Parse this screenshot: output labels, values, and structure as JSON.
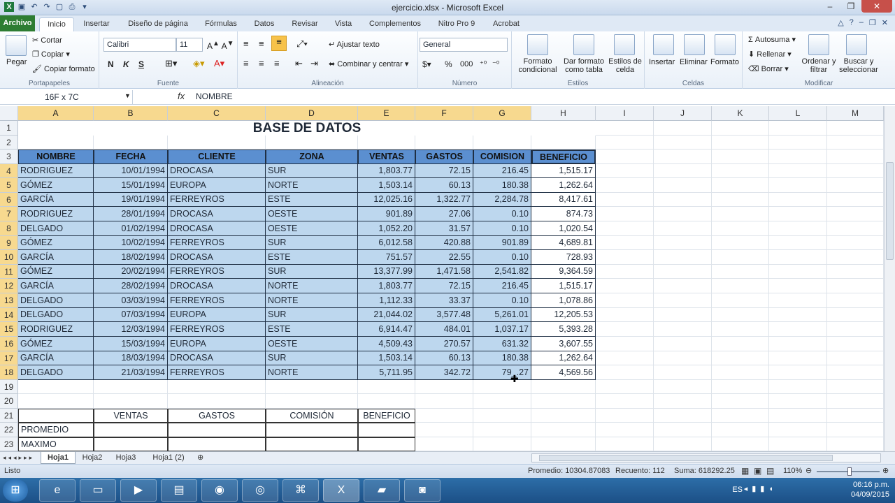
{
  "window": {
    "title": "ejercicio.xlsx - Microsoft Excel"
  },
  "ribbon_tabs": [
    "Archivo",
    "Inicio",
    "Insertar",
    "Diseño de página",
    "Fórmulas",
    "Datos",
    "Revisar",
    "Vista",
    "Complementos",
    "Nitro Pro 9",
    "Acrobat"
  ],
  "clipboard": {
    "paste": "Pegar",
    "cut": "Cortar",
    "copy": "Copiar",
    "format_painter": "Copiar formato",
    "label": "Portapapeles"
  },
  "font": {
    "name": "Calibri",
    "size": "11",
    "label": "Fuente",
    "bold": "N",
    "italic": "K",
    "underline": "S"
  },
  "alignment": {
    "wrap": "Ajustar texto",
    "merge": "Combinar y centrar",
    "label": "Alineación"
  },
  "number": {
    "format": "General",
    "label": "Número",
    "percent": "%",
    "thousands": "000"
  },
  "styles": {
    "conditional": "Formato condicional",
    "as_table": "Dar formato como tabla",
    "cell_styles": "Estilos de celda",
    "label": "Estilos"
  },
  "cells": {
    "insert": "Insertar",
    "delete": "Eliminar",
    "format": "Formato",
    "label": "Celdas"
  },
  "editing": {
    "autosum": "Autosuma",
    "fill": "Rellenar",
    "clear": "Borrar",
    "sort": "Ordenar y filtrar",
    "find": "Buscar y seleccionar",
    "label": "Modificar"
  },
  "formula_bar": {
    "name_box": "16F x 7C",
    "fx": "fx",
    "value": "NOMBRE"
  },
  "columns": [
    "A",
    "B",
    "C",
    "D",
    "E",
    "F",
    "G",
    "H",
    "I",
    "J",
    "K",
    "L",
    "M"
  ],
  "rows": [
    "1",
    "2",
    "3",
    "4",
    "5",
    "6",
    "7",
    "8",
    "9",
    "10",
    "11",
    "12",
    "13",
    "14",
    "15",
    "16",
    "17",
    "18",
    "19",
    "20",
    "21",
    "22",
    "23"
  ],
  "sheet_title": "BASE DE DATOS",
  "headers": [
    "NOMBRE",
    "FECHA",
    "CLIENTE",
    "ZONA",
    "VENTAS",
    "GASTOS",
    "COMISION",
    "BENEFICIO"
  ],
  "data": [
    [
      "RODRIGUEZ",
      "10/01/1994",
      "DROCASA",
      "SUR",
      "1,803.77",
      "72.15",
      "216.45",
      "1,515.17"
    ],
    [
      "GÓMEZ",
      "15/01/1994",
      "EUROPA",
      "NORTE",
      "1,503.14",
      "60.13",
      "180.38",
      "1,262.64"
    ],
    [
      "GARCÍA",
      "19/01/1994",
      "FERREYROS",
      "ESTE",
      "12,025.16",
      "1,322.77",
      "2,284.78",
      "8,417.61"
    ],
    [
      "RODRIGUEZ",
      "28/01/1994",
      "DROCASA",
      "OESTE",
      "901.89",
      "27.06",
      "0.10",
      "874.73"
    ],
    [
      "DELGADO",
      "01/02/1994",
      "DROCASA",
      "OESTE",
      "1,052.20",
      "31.57",
      "0.10",
      "1,020.54"
    ],
    [
      "GÓMEZ",
      "10/02/1994",
      "FERREYROS",
      "SUR",
      "6,012.58",
      "420.88",
      "901.89",
      "4,689.81"
    ],
    [
      "GARCÍA",
      "18/02/1994",
      "DROCASA",
      "ESTE",
      "751.57",
      "22.55",
      "0.10",
      "728.93"
    ],
    [
      "GÓMEZ",
      "20/02/1994",
      "FERREYROS",
      "SUR",
      "13,377.99",
      "1,471.58",
      "2,541.82",
      "9,364.59"
    ],
    [
      "GARCÍA",
      "28/02/1994",
      "DROCASA",
      "NORTE",
      "1,803.77",
      "72.15",
      "216.45",
      "1,515.17"
    ],
    [
      "DELGADO",
      "03/03/1994",
      "FERREYROS",
      "NORTE",
      "1,112.33",
      "33.37",
      "0.10",
      "1,078.86"
    ],
    [
      "DELGADO",
      "07/03/1994",
      "EUROPA",
      "SUR",
      "21,044.02",
      "3,577.48",
      "5,261.01",
      "12,205.53"
    ],
    [
      "RODRIGUEZ",
      "12/03/1994",
      "FERREYROS",
      "ESTE",
      "6,914.47",
      "484.01",
      "1,037.17",
      "5,393.28"
    ],
    [
      "GÓMEZ",
      "15/03/1994",
      "EUROPA",
      "OESTE",
      "4,509.43",
      "270.57",
      "631.32",
      "3,607.55"
    ],
    [
      "GARCÍA",
      "18/03/1994",
      "DROCASA",
      "SUR",
      "1,503.14",
      "60.13",
      "180.38",
      "1,262.64"
    ],
    [
      "DELGADO",
      "21/03/1994",
      "FERREYROS",
      "NORTE",
      "5,711.95",
      "342.72",
      "79_.27",
      "4,569.56"
    ]
  ],
  "summary": {
    "headers": [
      "VENTAS",
      "GASTOS",
      "COMISIÓN",
      "BENEFICIO"
    ],
    "row22": "PROMEDIO",
    "row23": "MAXIMO"
  },
  "sheets": [
    "Hoja1",
    "Hoja2",
    "Hoja3",
    "Hoja1 (2)"
  ],
  "status": {
    "ready": "Listo",
    "average": "Promedio: 10304.87083",
    "count": "Recuento: 112",
    "sum": "Suma: 618292.25",
    "zoom": "110%"
  },
  "tray": {
    "lang": "ES",
    "time": "06:16 p.m.",
    "date": "04/09/2015"
  }
}
